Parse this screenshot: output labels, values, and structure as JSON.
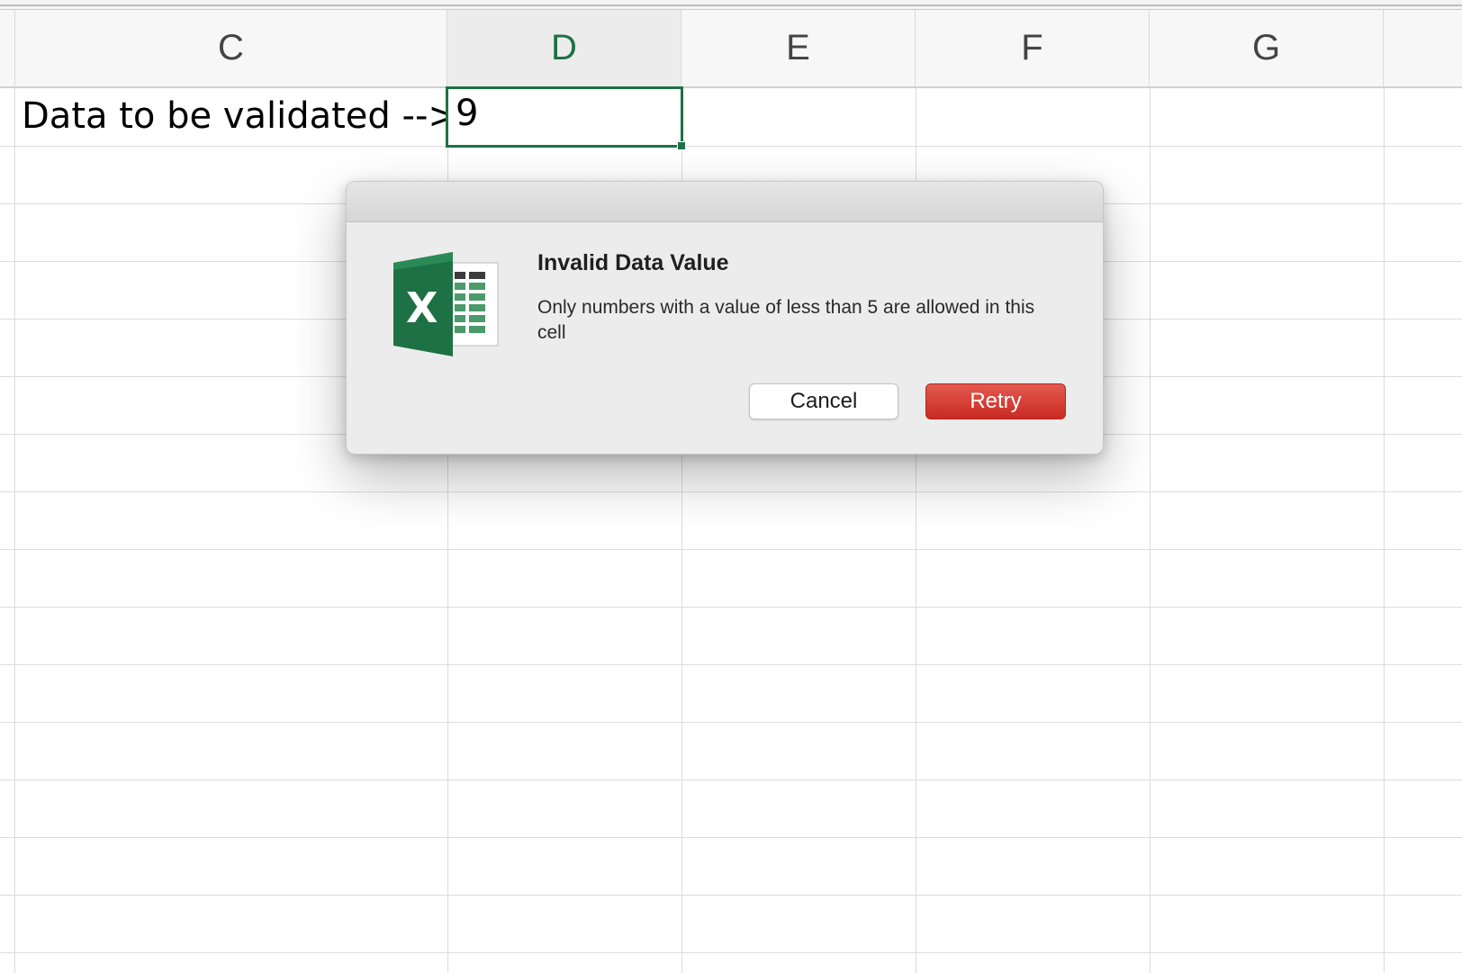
{
  "sheet": {
    "columns": [
      "C",
      "D",
      "E",
      "F",
      "G"
    ],
    "active_column": "D",
    "row_label_text": "Data to be validated -->",
    "selected_cell_value": "9",
    "accent_color": "#1e7145"
  },
  "dialog": {
    "icon": "excel-app-icon",
    "title": "Invalid Data Value",
    "message": "Only numbers with a value of less than 5 are allowed in this cell",
    "cancel_label": "Cancel",
    "retry_label": "Retry",
    "retry_color": "#d1352b"
  }
}
